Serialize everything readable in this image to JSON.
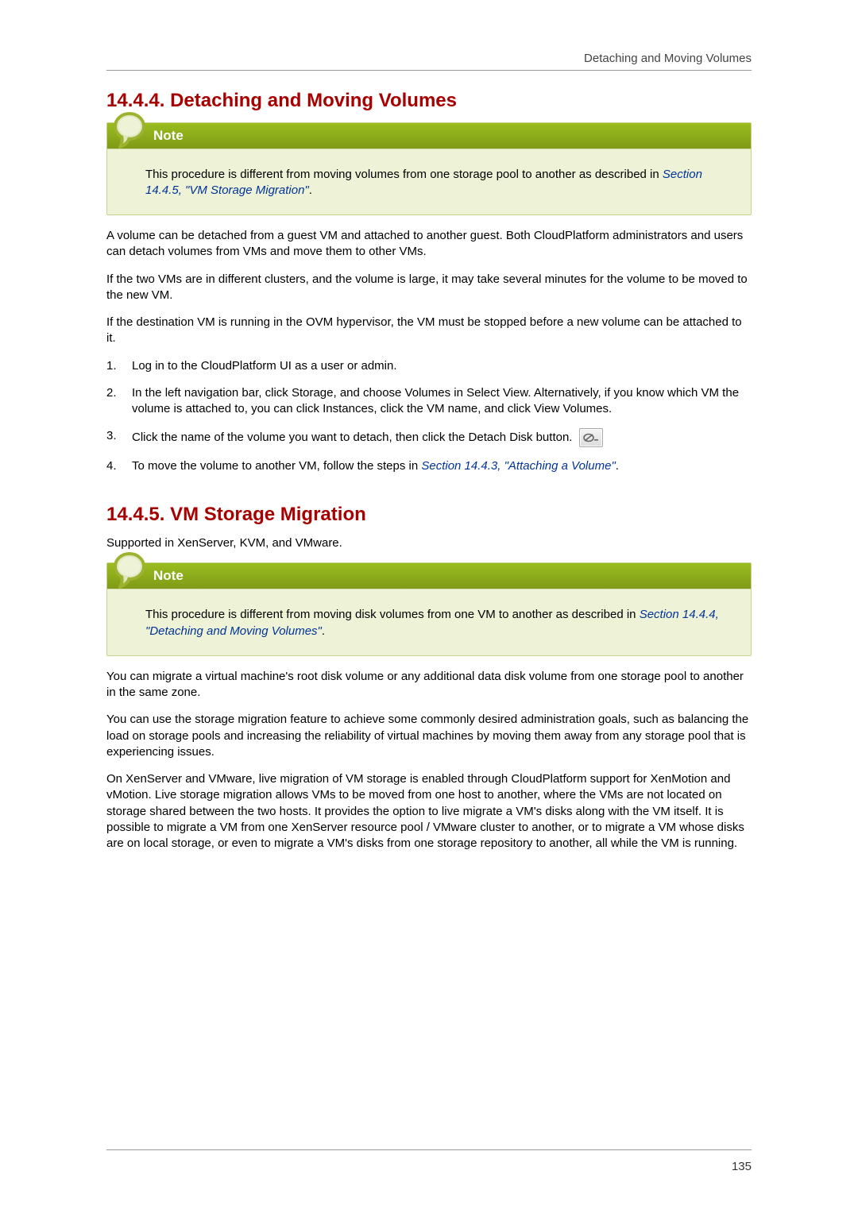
{
  "running_head": "Detaching and Moving Volumes",
  "section_a": {
    "number": "14.4.4.",
    "title": "Detaching and Moving Volumes",
    "note_label": "Note",
    "note_text_pre": "This procedure is different from moving volumes from one storage pool to another as described in ",
    "note_link": "Section 14.4.5, \"VM Storage Migration\"",
    "note_text_post": ".",
    "para1": "A volume can be detached from a guest VM and attached to another guest. Both CloudPlatform administrators and users can detach volumes from VMs and move them to other VMs.",
    "para2": "If the two VMs are in different clusters, and the volume is large, it may take several minutes for the volume to be moved to the new VM.",
    "para3": "If the destination VM is running in the OVM hypervisor, the VM must be stopped before a new volume can be attached to it.",
    "step1": "Log in to the CloudPlatform UI as a user or admin.",
    "step2": "In the left navigation bar, click Storage, and choose Volumes in Select View. Alternatively, if you know which VM the volume is attached to, you can click Instances, click the VM name, and click View Volumes.",
    "step3": "Click the name of the volume you want to detach, then click the Detach Disk button.",
    "step4_pre": "To move the volume to another VM, follow the steps in ",
    "step4_link": "Section 14.4.3, \"Attaching a Volume\"",
    "step4_post": "."
  },
  "section_b": {
    "number": "14.4.5.",
    "title": "VM Storage Migration",
    "support": "Supported in XenServer, KVM, and VMware.",
    "note_label": "Note",
    "note_text_pre": "This procedure is different from moving disk volumes from one VM to another as described in ",
    "note_link": "Section 14.4.4, \"Detaching and Moving Volumes\"",
    "note_text_post": ".",
    "para1": "You can migrate a virtual machine's root disk volume or any additional data disk volume from one storage pool to another in the same zone.",
    "para2": "You can use the storage migration feature to achieve some commonly desired administration goals, such as balancing the load on storage pools and increasing the reliability of virtual machines by moving them away from any storage pool that is experiencing issues.",
    "para3": "On XenServer and VMware, live migration of VM storage is enabled through CloudPlatform support for XenMotion and vMotion. Live storage migration allows VMs to be moved from one host to another, where the VMs are not located on storage shared between the two hosts. It provides the option to live migrate a VM's disks along with the VM itself. It is possible to migrate a VM from one XenServer resource pool / VMware cluster to another, or to migrate a VM whose disks are on local storage, or even to migrate a VM's disks from one storage repository to another, all while the VM is running."
  },
  "page_number": "135"
}
